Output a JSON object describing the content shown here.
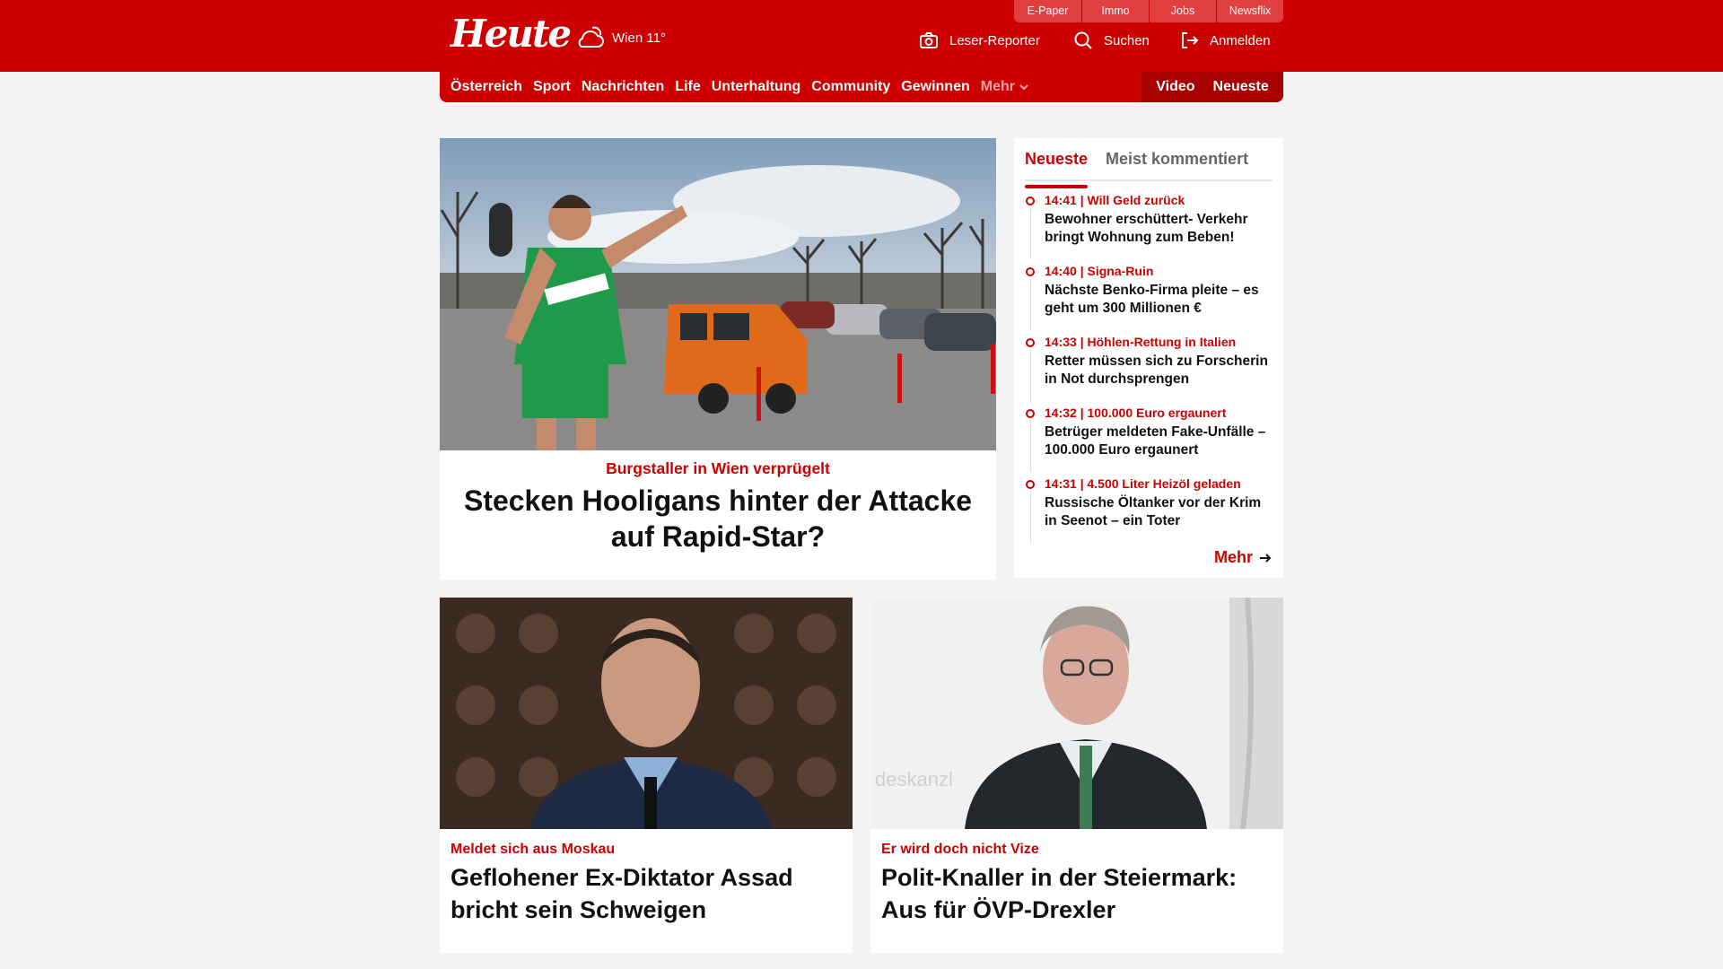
{
  "header": {
    "logo": "Heute",
    "weather": "Wien 11°",
    "top_links": [
      "E-Paper",
      "Immo",
      "Jobs",
      "Newsflix"
    ],
    "leser_reporter": "Leser-Reporter",
    "search": "Suchen",
    "login": "Anmelden"
  },
  "nav": {
    "items": [
      "Österreich",
      "Sport",
      "Nachrichten",
      "Life",
      "Unterhaltung",
      "Community",
      "Gewinnen"
    ],
    "more": "Mehr",
    "right": [
      "Video",
      "Neueste"
    ]
  },
  "hero": {
    "kicker": "Burgstaller in Wien verprügelt",
    "headline": "Stecken Hooligans hinter der Attacke auf Rapid-Star?"
  },
  "sidebar": {
    "tabs": [
      "Neueste",
      "Meist kommentiert"
    ],
    "items": [
      {
        "meta": "14:41 | Will Geld zurück",
        "text": "Bewohner erschüttert- Verkehr bringt Wohnung zum Beben!"
      },
      {
        "meta": "14:40 | Signa-Ruin",
        "text": "Nächste Benko-Firma pleite – es geht um 300 Millionen €"
      },
      {
        "meta": "14:33 | Höhlen-Rettung in Italien",
        "text": "Retter müssen sich zu Forscherin in Not durchsprengen"
      },
      {
        "meta": "14:32 | 100.000 Euro ergaunert",
        "text": "Betrüger meldeten Fake-Unfälle – 100.000 Euro ergaunert"
      },
      {
        "meta": "14:31 | 4.500 Liter Heizöl geladen",
        "text": "Russische Öltanker vor der Krim in Seenot – ein Toter"
      }
    ],
    "more": "Mehr"
  },
  "cards": [
    {
      "kicker": "Meldet sich aus Moskau",
      "headline": "Geflohener Ex-Diktator Assad bricht sein Schweigen"
    },
    {
      "kicker": "Er wird doch nicht Vize",
      "headline": "Polit-Knaller in der Steiermark: Aus für ÖVP-Drexler"
    }
  ],
  "colors": {
    "brand": "#cc0000",
    "nav_dark": "#a80000",
    "top_link": "#e14040",
    "page_bg": "#f4f4f4"
  }
}
